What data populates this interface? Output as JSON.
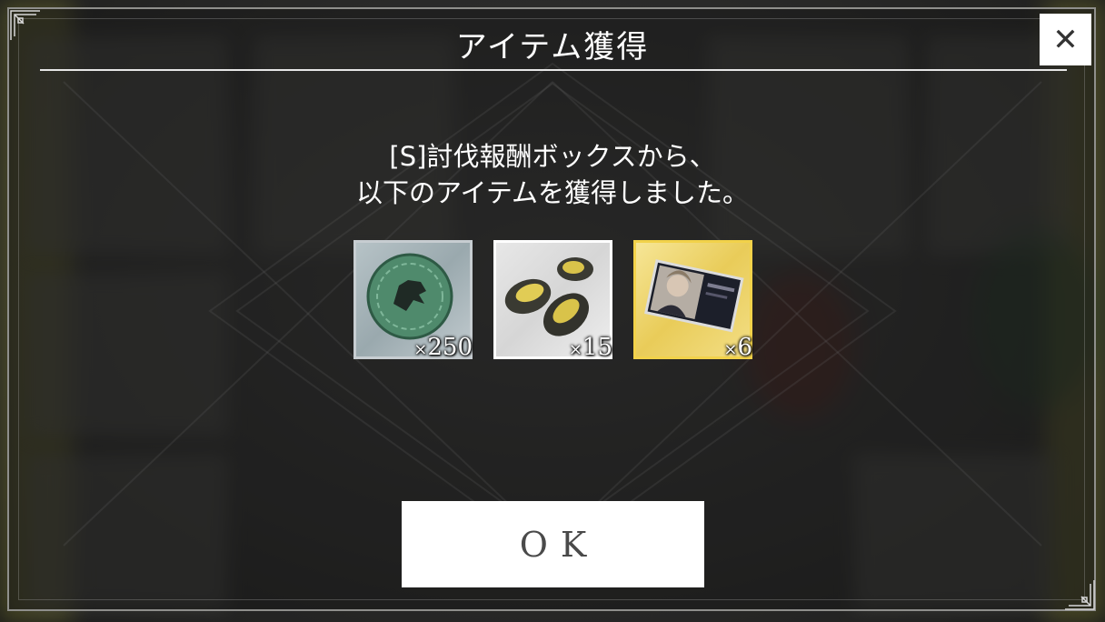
{
  "dialog": {
    "title": "アイテム獲得",
    "close_label": "✕",
    "message_line1": "[S]討伐報酬ボックスから、",
    "message_line2": "以下のアイテムを獲得しました。"
  },
  "items": [
    {
      "name": "medal",
      "icon": "dragon-medal-icon",
      "quantity": "250",
      "multiplier": "×",
      "frame_color": "#c7cdd1"
    },
    {
      "name": "ore",
      "icon": "gold-ore-icon",
      "quantity": "15",
      "multiplier": "×",
      "frame_color": "#ffffff"
    },
    {
      "name": "ticket",
      "icon": "character-ticket-icon",
      "quantity": "6",
      "multiplier": "×",
      "frame_color": "#f2d24a"
    }
  ],
  "ok_button": {
    "label": "OK"
  },
  "colors": {
    "overlay": "#1e1e1e",
    "text": "#ffffff",
    "button_bg": "#ffffff",
    "button_text": "#4a4a4a"
  }
}
